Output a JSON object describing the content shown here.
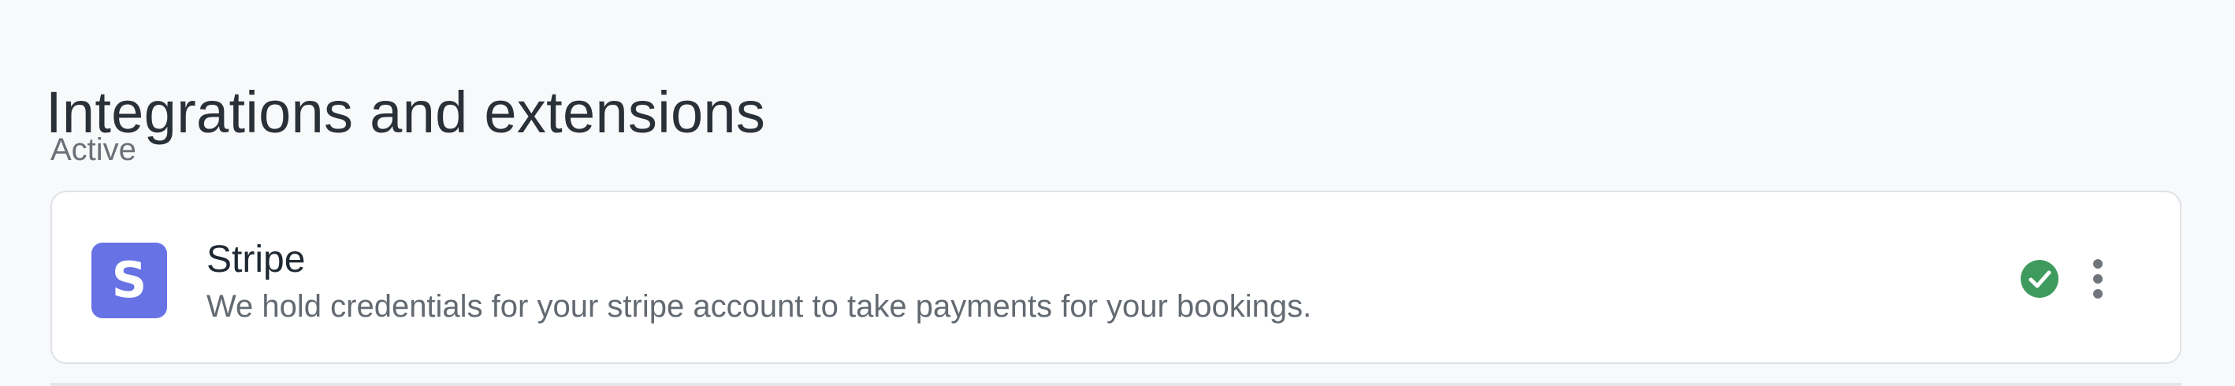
{
  "page": {
    "title": "Integrations and extensions"
  },
  "sections": {
    "active": {
      "label": "Active",
      "items": [
        {
          "logo_letter": "S",
          "name": "Stripe",
          "description": "We hold credentials for your stripe account to take payments for your bookings.",
          "status": "active",
          "status_icon": "check-circle-icon",
          "menu_icon": "more-vertical-icon"
        }
      ]
    }
  },
  "colors": {
    "stripe_brand": "#6772e5",
    "status_success": "#3e9b5d",
    "menu_icon": "#70757c"
  }
}
